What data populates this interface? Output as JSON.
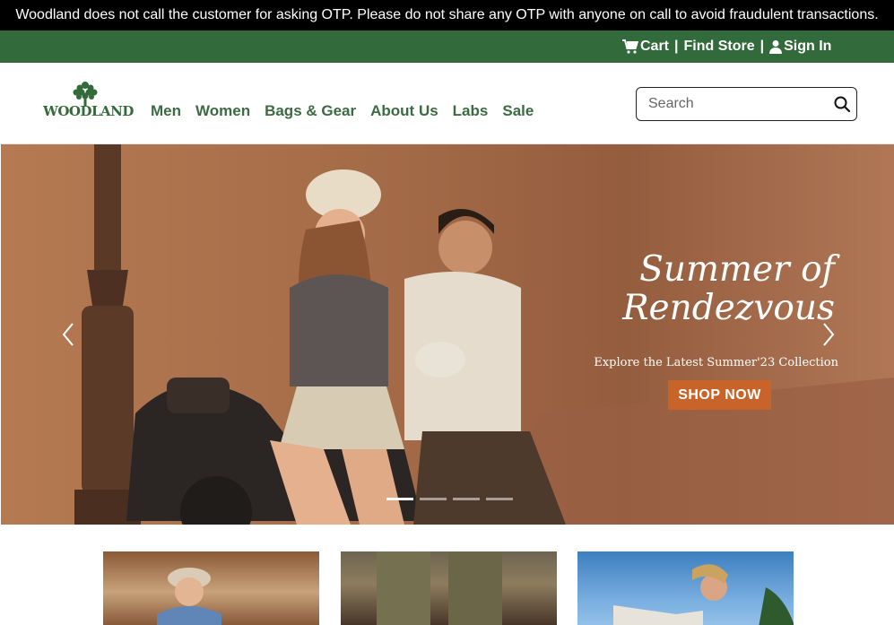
{
  "notice": {
    "text": "Woodland does not call the customer for asking OTP. Please do not share any OTP with anyone on call to avoid fraudulent transactions."
  },
  "utility": {
    "cart": "Cart",
    "separator": "|",
    "find_store": "Find Store",
    "sign_in": "Sign In"
  },
  "brand": {
    "logo_text": "WOODLAND"
  },
  "nav": [
    "Men",
    "Women",
    "Bags & Gear",
    "About Us",
    "Labs",
    "Sale"
  ],
  "search": {
    "placeholder": "Search",
    "value": ""
  },
  "hero": {
    "title_line1": "Summer of",
    "title_line2": "Rendezvous",
    "subtitle": "Explore the Latest Summer'23 Collection",
    "cta": "SHOP NOW",
    "slide_count": 4,
    "active_slide": 1
  },
  "colors": {
    "brand_green": "#336a3b",
    "nav_green": "#3c6b43",
    "cta_orange": "#c8642a",
    "notice_bg": "#000000"
  },
  "icons": {
    "cart": "cart-icon",
    "user": "user-icon",
    "search": "search-icon",
    "prev": "chevron-left-icon",
    "next": "chevron-right-icon"
  }
}
